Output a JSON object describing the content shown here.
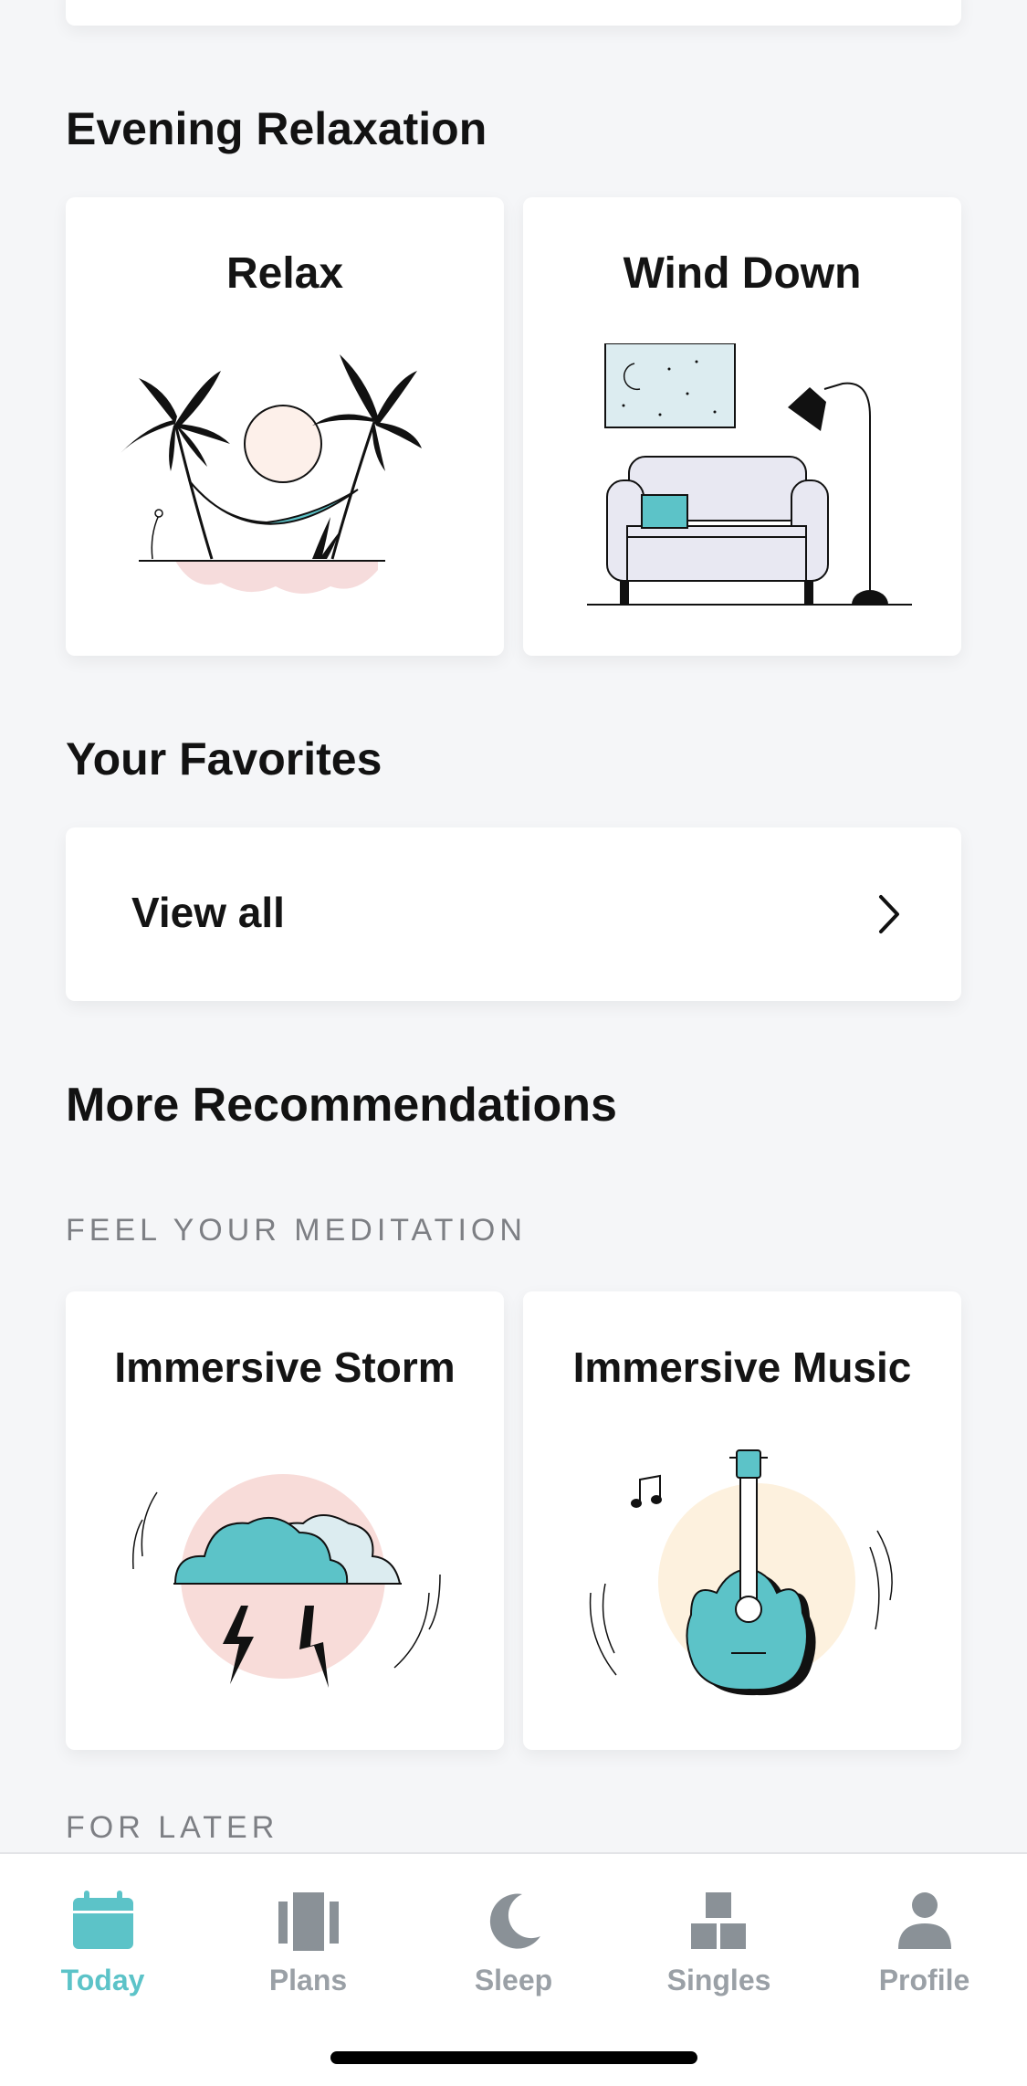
{
  "sections": {
    "evening": {
      "title": "Evening Relaxation",
      "tiles": [
        {
          "title": "Relax"
        },
        {
          "title": "Wind Down"
        }
      ]
    },
    "favorites": {
      "title": "Your Favorites",
      "row_label": "View all"
    },
    "more": {
      "title": "More Recommendations",
      "group1_label": "FEEL YOUR MEDITATION",
      "tiles": [
        {
          "title": "Immersive Storm"
        },
        {
          "title": "Immersive Music"
        }
      ],
      "group2_label": "FOR LATER"
    }
  },
  "tabbar": {
    "items": [
      {
        "label": "Today",
        "icon": "calendar-icon",
        "active": true
      },
      {
        "label": "Plans",
        "icon": "plans-icon",
        "active": false
      },
      {
        "label": "Sleep",
        "icon": "moon-icon",
        "active": false
      },
      {
        "label": "Singles",
        "icon": "blocks-icon",
        "active": false
      },
      {
        "label": "Profile",
        "icon": "person-icon",
        "active": false
      }
    ]
  },
  "colors": {
    "accent": "#5cc3c8",
    "inactive": "#8a9197",
    "background": "#f5f6f8",
    "card": "#ffffff"
  }
}
